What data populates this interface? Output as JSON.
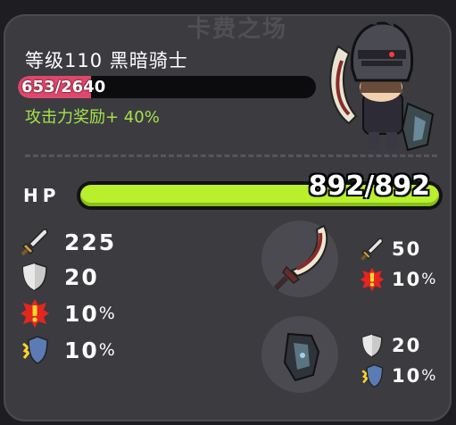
{
  "banner": "卡费之场",
  "header": {
    "title": "等级110  黑暗骑士",
    "xp_text": "653/2640",
    "xp_fraction": 0.247,
    "bonus": "攻击力奖励+ 40%"
  },
  "hp": {
    "label": "HP",
    "text": "892/892",
    "fraction": 1.0
  },
  "stats": {
    "attack": "225",
    "defense": "20",
    "crit": "10",
    "crit_unit": "%",
    "block": "10",
    "block_unit": "%"
  },
  "weapon": {
    "attack": "50",
    "crit": "10",
    "crit_unit": "%"
  },
  "shield": {
    "defense": "20",
    "block": "10",
    "block_unit": "%"
  },
  "colors": {
    "hp": "#b9ef2c",
    "xp": "#e0476d",
    "bonus": "#a4e34a"
  }
}
